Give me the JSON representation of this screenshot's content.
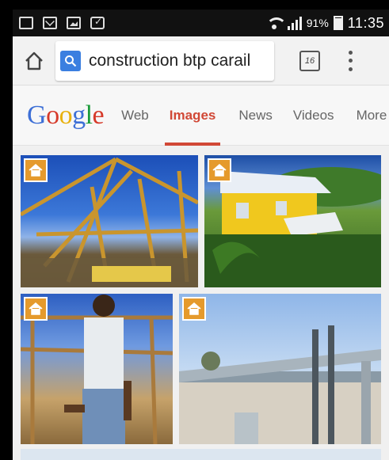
{
  "status_bar": {
    "notification_icons": [
      "photo-notification-icon",
      "mail-icon",
      "image-icon",
      "clipboard-check-icon"
    ],
    "battery_percent": "91%",
    "battery_level": 0.91,
    "time": "11:35"
  },
  "url_bar": {
    "query": "construction btp carail",
    "tab_count": "16"
  },
  "google_nav": {
    "logo": "Google",
    "tabs": [
      {
        "label": "Web",
        "active": false
      },
      {
        "label": "Images",
        "active": true
      },
      {
        "label": "News",
        "active": false
      },
      {
        "label": "Videos",
        "active": false
      },
      {
        "label": "More",
        "active": false
      }
    ]
  },
  "image_results": [
    {
      "name": "roof-frame-image",
      "has_home_badge": true
    },
    {
      "name": "yellow-house-image",
      "has_home_badge": true
    },
    {
      "name": "worker-photo-image",
      "has_home_badge": true
    },
    {
      "name": "building-roof-pipes-image",
      "has_home_badge": true
    }
  ],
  "colors": {
    "active_tab": "#d14836",
    "search_icon_bg": "#3b7fe0",
    "home_badge": "#e59a2c"
  }
}
